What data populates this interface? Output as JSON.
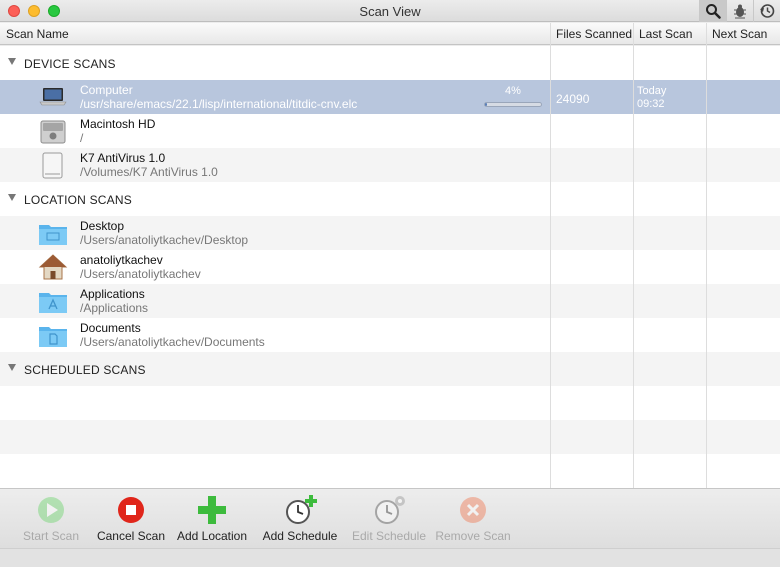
{
  "window": {
    "title": "Scan View"
  },
  "toolbar": {
    "icons": [
      "search-icon",
      "bug-icon",
      "history-icon"
    ]
  },
  "columns": [
    "Scan Name",
    "Files Scanned",
    "Last Scan",
    "Next Scan"
  ],
  "groups": {
    "device": "DEVICE SCANS",
    "location": "LOCATION SCANS",
    "scheduled": "SCHEDULED SCANS"
  },
  "device_items": [
    {
      "name": "Computer",
      "path": "/usr/share/emacs/22.1/lisp/international/titdic-cnv.elc",
      "icon": "laptop-icon",
      "progress_label": "4%",
      "progress": 0.04,
      "files_scanned": "24090",
      "last_scan_day": "Today",
      "last_scan_time": "09:32"
    },
    {
      "name": "Macintosh HD",
      "path": "/",
      "icon": "hard-drive-icon"
    },
    {
      "name": "K7 AntiVirus 1.0",
      "path": "/Volumes/K7 AntiVirus 1.0",
      "icon": "disk-image-icon"
    }
  ],
  "location_items": [
    {
      "name": "Desktop",
      "path": "/Users/anatoliytkachev/Desktop",
      "icon": "desktop-folder-icon"
    },
    {
      "name": "anatoliytkachev",
      "path": "/Users/anatoliytkachev",
      "icon": "home-folder-icon"
    },
    {
      "name": "Applications",
      "path": "/Applications",
      "icon": "applications-folder-icon"
    },
    {
      "name": "Documents",
      "path": "/Users/anatoliytkachev/Documents",
      "icon": "documents-folder-icon"
    }
  ],
  "actions": [
    {
      "label": "Start Scan",
      "icon": "play-icon",
      "enabled": false
    },
    {
      "label": "Cancel Scan",
      "icon": "stop-icon",
      "enabled": true
    },
    {
      "label": "Add Location",
      "icon": "plus-icon",
      "enabled": true
    },
    {
      "label": "Add Schedule",
      "icon": "clock-add-icon",
      "enabled": true
    },
    {
      "label": "Edit Schedule",
      "icon": "clock-gear-icon",
      "enabled": false
    },
    {
      "label": "Remove Scan",
      "icon": "remove-icon",
      "enabled": false
    }
  ],
  "colors": {
    "selection": "#b8c6dd",
    "accent_green": "#3dbb3d",
    "stop_red": "#e0261b",
    "remove_orange": "#f07a55"
  }
}
